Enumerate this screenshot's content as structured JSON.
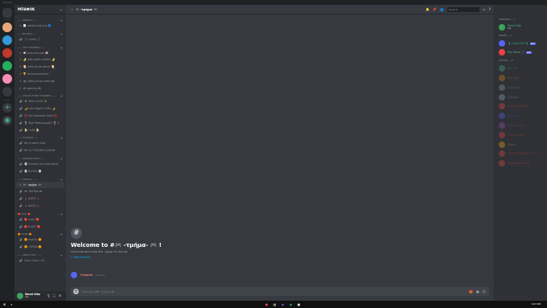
{
  "server": {
    "name": "ΜΠΑΦΟΚ"
  },
  "categories": [
    {
      "label": "—— ΚΑΝΑΛΙΑ ——",
      "channels": [
        {
          "prefix": "#",
          "name": "📃 mee6-auto-trip 🔵"
        }
      ]
    },
    {
      "label": "—— ΜΟΥΣΙΚΗ ——",
      "channels": [
        {
          "prefix": "🔊",
          "name": "🎵 rythm 🎵"
        }
      ]
    },
    {
      "label": "—— TEXT CHANNELS ——",
      "channels": [
        {
          "prefix": "#",
          "name": "📢 ανα-κοίνωση 📢"
        },
        {
          "prefix": "#",
          "name": "🌛 late-night-chatter 🌛"
        },
        {
          "prefix": "#",
          "name": "📜 rules-of-da-discor 📜"
        },
        {
          "prefix": "#",
          "name": "🏆 announcements"
        },
        {
          "prefix": "#",
          "name": "📹 video-of-da-video 📹"
        },
        {
          "prefix": "#",
          "name": "🎮 gaming 🎮"
        }
      ]
    },
    {
      "label": "—— CHILLIN' FUNNY CHANNELS ——",
      "channels": [
        {
          "prefix": "🔊",
          "name": "🌴 Vibe Chillin 🌴"
        },
        {
          "prefix": "🔊",
          "name": "🌙 Late Night Chillin 🌙"
        },
        {
          "prefix": "🔊",
          "name": "🚫 No Complete Zone 🚫"
        },
        {
          "prefix": "🔊",
          "name": "🍷 Real Μπάλωμαθεν 🍷 Χ"
        },
        {
          "prefix": "🔊",
          "name": "🍺 Ουζό 🍺"
        }
      ]
    },
    {
      "label": "—— ΠΑΙΧΝΙΔΙΑ ——",
      "channels": [
        {
          "prefix": "🔊",
          "name": "🎮 la tosim club"
        },
        {
          "prefix": "🔊",
          "name": "🎮 LA TOSURA CLUB 🎮"
        }
      ]
    },
    {
      "label": "—— GANGING ROOM ——",
      "channels": [
        {
          "prefix": "🔊",
          "name": "💀 Dumbo των οπλιτάκια"
        },
        {
          "prefix": "🔊",
          "name": "💀 ΒΟΥΚΑ 💀"
        }
      ]
    },
    {
      "label": "—— ΚΑΝΑΛΙΑ ——",
      "channels": [
        {
          "prefix": "#",
          "name": "🎮 -τμήμα- 🎮",
          "active": true
        },
        {
          "prefix": "🔊",
          "name": "🎮 ΤΜΗΜΑ 🎮"
        },
        {
          "prefix": "🔊",
          "name": "🔺 ΒΙΑΤΣ 🔺"
        },
        {
          "prefix": "🔊",
          "name": "🔺 ΒΙΑΤΣ 🔺"
        }
      ]
    },
    {
      "label": "🔴 Β.ΚΑΤ 🔴",
      "channels": [
        {
          "prefix": "🔊",
          "name": "🔴 main 🔴"
        },
        {
          "prefix": "🔊",
          "name": "🔴 Β.ΚΑΤ 🔴"
        }
      ]
    },
    {
      "label": "🟠 ΣΥΡΙΖΑ 🟠",
      "channels": [
        {
          "prefix": "🔊",
          "name": "🟠 συρίζα 🟠"
        },
        {
          "prefix": "🔊",
          "name": "🟠 ΣΥΡΙΖΑ 🟠"
        }
      ]
    },
    {
      "label": "—— ΑΝΤΙΑ ΑΥΑΚΥ ——",
      "channels": [
        {
          "prefix": "🔊",
          "name": "User Count: 16"
        }
      ]
    }
  ],
  "user": {
    "name": "Weed Vibe",
    "tag": "#Rj"
  },
  "channel": {
    "name": "🎮 -τμήμα- 🎮",
    "welcome_title": "Welcome to #🎮 -τμήμα- 🎮 !",
    "welcome_sub": "This is the start of the #🎮 -τμήμα- 🎮 channel.",
    "edit_label": "Edit Channel"
  },
  "message": {
    "author": "Γνωμικό",
    "time": "Yesterday"
  },
  "composer": {
    "placeholder": "Message #🎮 -τμήμα- 🎮"
  },
  "header": {
    "search_placeholder": "Search"
  },
  "members": {
    "groups": [
      {
        "label": "ΠΡΟΕΔΡΟΣ — 1",
        "items": [
          {
            "name": "Weed Vibe",
            "sub": "#Rj",
            "color": "#3ba55d",
            "online": true
          }
        ]
      },
      {
        "label": "ONLINE — 2",
        "items": [
          {
            "name": "🎙 I Just Chill 🎙",
            "bot": "BOT",
            "color": "#5865f2",
            "online": true
          },
          {
            "name": "Hex Music 🎵",
            "bot": "BOT",
            "color": "#ed4245",
            "online": true
          }
        ]
      },
      {
        "label": "OFFLINE — 12",
        "items": [
          {
            "name": "Alex_b9",
            "color": "#43b581"
          },
          {
            "name": "Alex_bot",
            "color": "#e67e22"
          },
          {
            "name": "Βαγγέλης",
            "color": "#95a5a6"
          },
          {
            "name": "Αλβεραξ",
            "color": "#99aab5"
          },
          {
            "name": "Βαγγέλης Μαζη",
            "color": "#f04747"
          },
          {
            "name": "Mr Tsouri",
            "color": "#5865f2"
          },
          {
            "name": "Μιχ Γεωργίου",
            "color": "#9b59b6"
          },
          {
            "name": "Γιώργος Mob",
            "color": "#f04747"
          },
          {
            "name": "Σάκης",
            "color": "#faa61a"
          },
          {
            "name": "ΤΑΣΟΣ ΓΑΛΑΝΟΥ 12 12",
            "color": "#f04747"
          },
          {
            "name": "Ψυχή Ασήμιου 66",
            "color": "#f04747"
          }
        ]
      }
    ]
  },
  "taskbar": {
    "time": "9:23 PM"
  }
}
